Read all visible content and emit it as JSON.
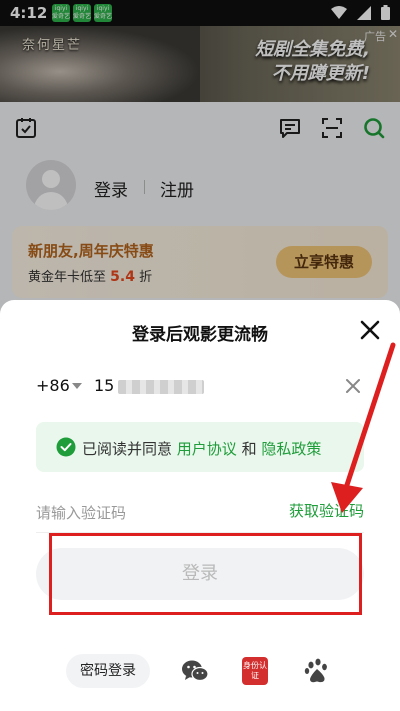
{
  "status_bar": {
    "time": "4:12",
    "notif1": "iqiyi 爱奇艺",
    "notif2": "iqiyi 爱奇艺",
    "notif3": "iqiyi 爱奇艺"
  },
  "ad_banner": {
    "show_title": "奈何星芒",
    "slogan_line1": "短剧全集免费,",
    "slogan_line2": "不用蹲更新!",
    "ad_label": "广告",
    "close_symbol": "✕"
  },
  "profile": {
    "login_label": "登录",
    "register_label": "注册"
  },
  "promo": {
    "title": "新朋友,周年庆特惠",
    "subtitle_prefix": "黄金年卡低至 ",
    "discount": "5.4",
    "subtitle_suffix": " 折",
    "button_label": "立享特惠"
  },
  "login_sheet": {
    "title": "登录后观影更流畅",
    "country_code": "+86",
    "phone_prefix": "15",
    "agree_text": "已阅读并同意",
    "agree_link1": "用户协议",
    "agree_and": "和",
    "agree_link2": "隐私政策",
    "code_placeholder": "请输入验证码",
    "get_code_label": "获取验证码",
    "login_button": "登录",
    "password_login": "密码登录",
    "id_auth_label": "身份认证"
  },
  "colors": {
    "brand_green": "#1f9d3a",
    "annotation_red": "#dd1f1f",
    "promo_orange": "#b5651d"
  },
  "icons": [
    "calendar-check-icon",
    "message-icon",
    "scan-icon",
    "search-icon",
    "close-icon",
    "clear-icon",
    "check-circle-icon",
    "wechat-icon",
    "id-auth-icon",
    "baidu-icon"
  ]
}
